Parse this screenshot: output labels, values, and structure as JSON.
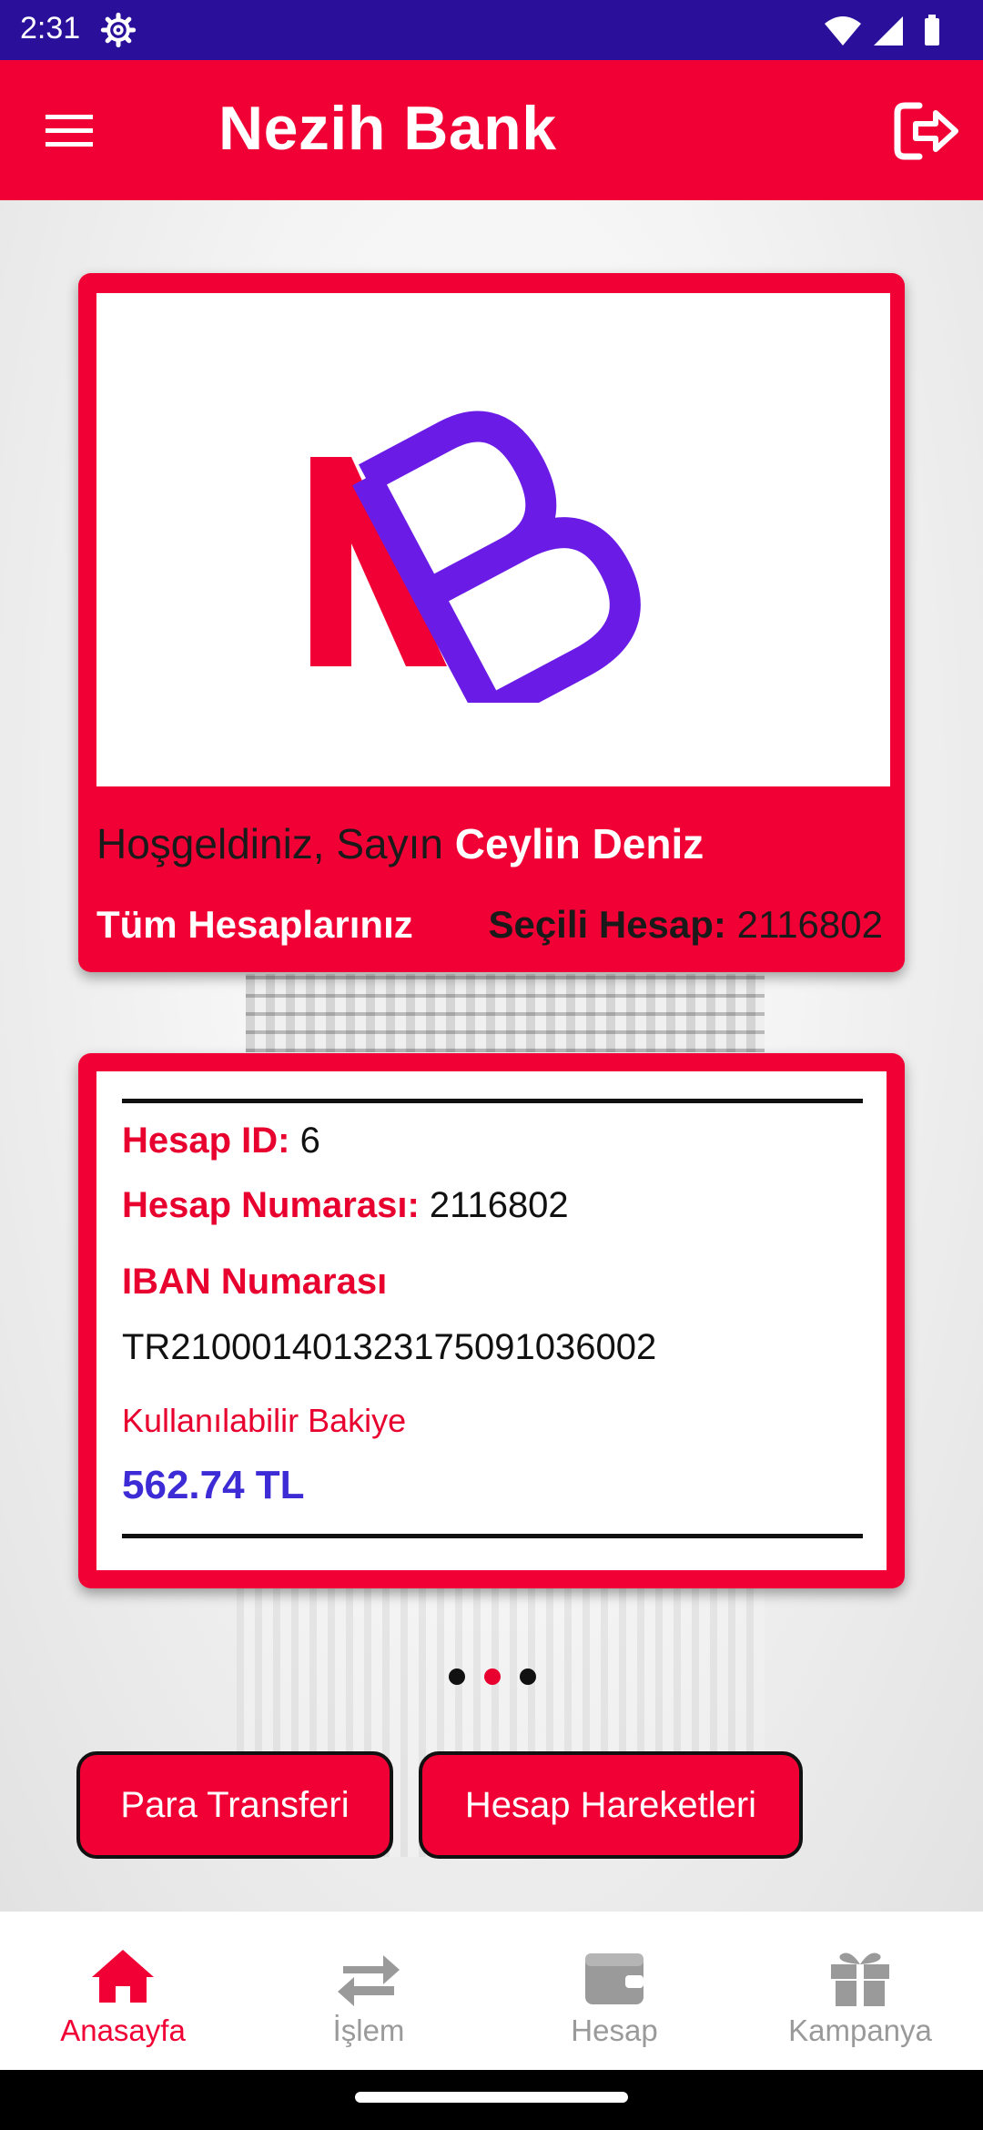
{
  "status_bar": {
    "time": "2:31"
  },
  "app_bar": {
    "title": "Nezih Bank"
  },
  "hero": {
    "greeting": "Hoşgeldiniz, Sayın",
    "customer_name": "Ceylin Deniz",
    "all_accounts_label": "Tüm Hesaplarınız",
    "selected_account_label": "Seçili Hesap:",
    "selected_account_value": "2116802"
  },
  "account": {
    "id_label": "Hesap ID:",
    "id_value": "6",
    "number_label": "Hesap Numarası:",
    "number_value": "2116802",
    "iban_label": "IBAN Numarası",
    "iban_value": "TR210001401323175091036002",
    "balance_label": "Kullanılabilir Bakiye",
    "balance_value": "562.74 TL"
  },
  "pager": {
    "count": 3,
    "active_index": 1
  },
  "actions": {
    "transfer_label": "Para Transferi",
    "history_label": "Hesap Hareketleri"
  },
  "bottom_nav": {
    "items": [
      {
        "label": "Anasayfa",
        "icon": "home-icon",
        "active": true
      },
      {
        "label": "İşlem",
        "icon": "transfer-arrows-icon",
        "active": false
      },
      {
        "label": "Hesap",
        "icon": "wallet-icon",
        "active": false
      },
      {
        "label": "Kampanya",
        "icon": "gift-icon",
        "active": false
      }
    ]
  },
  "colors": {
    "brand_red": "#f00034",
    "status_bar": "#2a0f9a",
    "balance_blue": "#3d2bd6",
    "logo_purple": "#6a1be6",
    "inactive_gray": "#9a9a9a"
  }
}
